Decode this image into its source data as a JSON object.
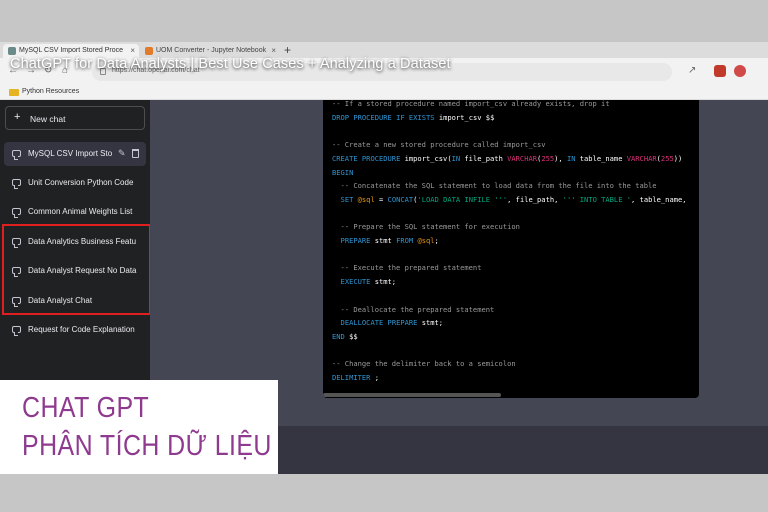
{
  "video": {
    "title": "ChatGPT for Data Analysts | Best Use Cases + Analyzing a Dataset"
  },
  "browser": {
    "tabs": [
      {
        "label": "MySQL CSV Import Stored Proce",
        "close": "×"
      },
      {
        "label": "UOM Converter - Jupyter Notebook",
        "close": "×"
      }
    ],
    "new_tab": "+",
    "url": "https://chat.openai.com/chat",
    "bookmark": "Python Resources"
  },
  "sidebar": {
    "new_chat": "New chat",
    "new_chat_icon": "+",
    "chats": [
      {
        "label": "MySQL CSV Import Stor",
        "active": true
      },
      {
        "label": "Unit Conversion Python Code",
        "active": false
      },
      {
        "label": "Common Animal Weights List",
        "active": false
      },
      {
        "label": "Data Analytics Business Featu",
        "active": false
      },
      {
        "label": "Data Analyst Request No Data",
        "active": false
      },
      {
        "label": "Data Analyst Chat",
        "active": false
      },
      {
        "label": "Request for Code Explanation",
        "active": false
      }
    ],
    "highlight_color": "#e02020"
  },
  "code_lines": [
    "-- If a stored procedure named import_csv already exists, drop it",
    "DROP PROCEDURE IF EXISTS import_csv $$",
    "",
    "-- Create a new stored procedure called import_csv",
    "CREATE PROCEDURE import_csv(IN file_path VARCHAR(255), IN table_name VARCHAR(255))",
    "BEGIN",
    "  -- Concatenate the SQL statement to load data from the file into the table",
    "  SET @sql = CONCAT('LOAD DATA INFILE ''', file_path, ''' INTO TABLE ', table_name,",
    "",
    "  -- Prepare the SQL statement for execution",
    "  PREPARE stmt FROM @sql;",
    "",
    "  -- Execute the prepared statement",
    "  EXECUTE stmt;",
    "",
    "  -- Deallocate the prepared statement",
    "  DEALLOCATE PREPARE stmt;",
    "END $$",
    "",
    "-- Change the delimiter back to a semicolon",
    "DELIMITER ;"
  ],
  "watermark": {
    "line1": "CHAT GPT",
    "line2": "PHÂN TÍCH DỮ LIỆU",
    "color": "#8e3a8f"
  },
  "colors": {
    "sidebar_bg": "#202123",
    "main_bg": "#444654",
    "code_bg": "#000000",
    "keyword": "#2e95d3",
    "type": "#df3079",
    "string": "#00a67d",
    "variable": "#e9950c"
  }
}
